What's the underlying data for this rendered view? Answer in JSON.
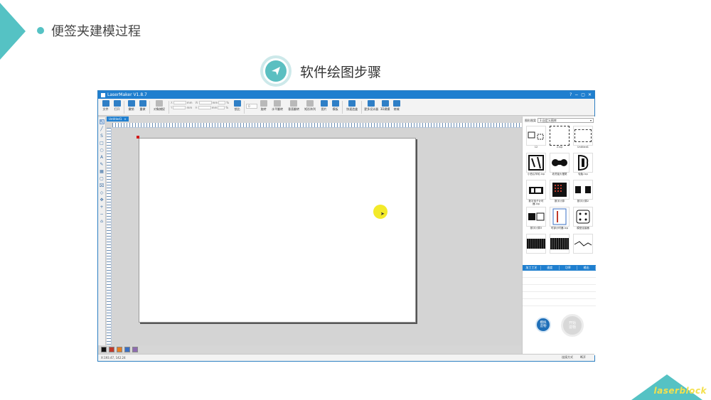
{
  "slide": {
    "title": "便签夹建模过程",
    "step_title": "软件绘图步骤",
    "brand": "laserblock",
    "accent_color": "#55c2c4"
  },
  "window": {
    "title": "LaserMaker V1.8.7",
    "controls": [
      "?",
      "−",
      "▢",
      "✕"
    ]
  },
  "toolbar": {
    "items": [
      {
        "label": "文件",
        "icon": "folder-icon"
      },
      {
        "label": "打开",
        "icon": "open-icon"
      },
      {
        "label": "撤销",
        "icon": "undo-icon"
      },
      {
        "label": "重做",
        "icon": "redo-icon"
      },
      {
        "label": "对象捕捉",
        "icon": "snap-icon"
      }
    ],
    "fields": [
      {
        "label": "X",
        "unit": "mm"
      },
      {
        "label": "Y",
        "unit": "mm"
      },
      {
        "label": "W",
        "unit": "mm"
      },
      {
        "label": "H",
        "unit": "mm"
      }
    ],
    "percent_unit": "%",
    "lock_label": "锁比",
    "rotate_value": "0",
    "tools": [
      {
        "label": "旋转",
        "icon": "rotate-icon"
      },
      {
        "label": "水平翻转",
        "icon": "flip-h-icon"
      },
      {
        "label": "垂直翻转",
        "icon": "flip-v-icon"
      },
      {
        "label": "矩形阵列",
        "icon": "array-icon"
      },
      {
        "label": "图片",
        "icon": "image-icon"
      },
      {
        "label": "模板",
        "icon": "template-icon"
      },
      {
        "label": "快速造盒",
        "icon": "box-icon"
      },
      {
        "label": "更多设计器",
        "icon": "designer-icon"
      },
      {
        "label": "3D建模",
        "icon": "3d-icon"
      },
      {
        "label": "商城",
        "icon": "cart-icon"
      }
    ]
  },
  "document": {
    "tab_label": "Untitled1"
  },
  "left_tools": [
    "↖",
    "╱",
    "S",
    "□",
    "○",
    "A",
    "✎",
    "▦",
    "▢",
    "⌧",
    "◇",
    "✥",
    "+",
    "−",
    "⌂"
  ],
  "swatches": [
    "#111111",
    "#c0392b",
    "#e67e22",
    "#3a6fc4",
    "#8e6bb0"
  ],
  "status": {
    "coords": "X:193.47, 142.24",
    "connection": "连接方式",
    "state": "断开"
  },
  "library": {
    "label": "图形图案",
    "selected": "3.自定义图库",
    "items": [
      {
        "name": "12"
      },
      {
        "name": "2.lxp"
      },
      {
        "name": "Untitled1"
      },
      {
        "name": "小西瓜车轮.lxp"
      },
      {
        "name": "老虎摇头摆尾"
      },
      {
        "name": "轮胎.lxp"
      },
      {
        "name": "数字电子计时器.lxp"
      },
      {
        "name": "数字计算"
      },
      {
        "name": "数字计算2"
      },
      {
        "name": "数字计算3"
      },
      {
        "name": "时钟计时器.lxp"
      },
      {
        "name": "模型连接器"
      },
      {
        "name": "",
        "partial": true
      },
      {
        "name": "",
        "partial": true
      },
      {
        "name": "",
        "partial": true
      }
    ]
  },
  "process": {
    "columns": [
      "加工工艺",
      "速度",
      "功率",
      "输出"
    ]
  },
  "buttons": {
    "simulate": "模拟\n造物",
    "start": "开始\n造物"
  }
}
